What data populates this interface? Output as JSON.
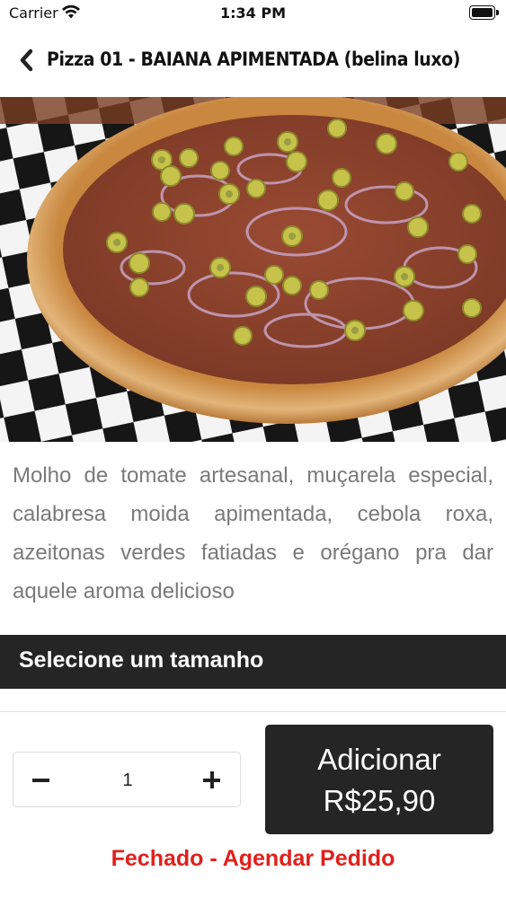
{
  "status_bar": {
    "carrier": "Carrier",
    "time": "1:34 PM",
    "icons": [
      "wifi-icon",
      "battery-icon"
    ]
  },
  "nav": {
    "back_icon": "chevron-left-icon",
    "title": "Pizza 01 - BAIANA APIMENTADA (belina luxo)"
  },
  "product": {
    "description": "Molho de tomate artesanal, muçarela especial, calabresa moida apimentada, cebola roxa, azeitonas verdes fatiadas e orégano pra dar aquele aroma delicioso"
  },
  "size_section": {
    "title": "Selecione um tamanho"
  },
  "cart": {
    "quantity": "1",
    "add_label": "Adicionar",
    "price": "R$25,90"
  },
  "store_status": {
    "text": "Fechado - Agendar Pedido",
    "color": "#e0201d"
  },
  "colors": {
    "dark": "#252525",
    "text_muted": "#7a7a7a",
    "accent_red": "#e0201d"
  }
}
